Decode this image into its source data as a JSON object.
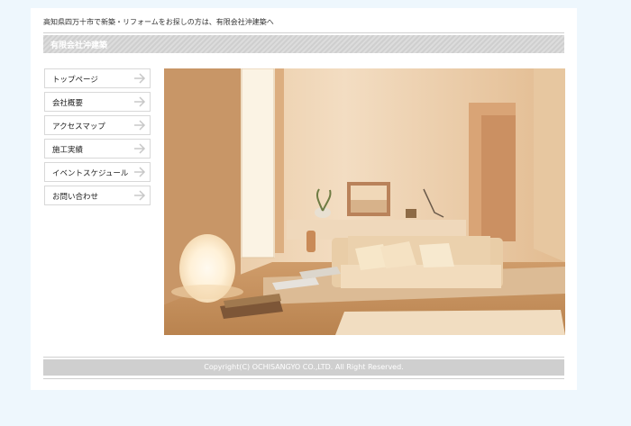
{
  "header": {
    "tagline": "高知県四万十市で新築・リフォームをお探しの方は、有限会社沖建築へ",
    "company_name": "有限会社沖建築"
  },
  "nav": {
    "items": [
      {
        "label": "トップページ",
        "icon": "arrow-right-icon"
      },
      {
        "label": "会社概要",
        "icon": "arrow-right-icon"
      },
      {
        "label": "アクセスマップ",
        "icon": "arrow-right-icon"
      },
      {
        "label": "施工実績",
        "icon": "arrow-right-icon"
      },
      {
        "label": "イベントスケジュール",
        "icon": "arrow-right-icon"
      },
      {
        "label": "お問い合わせ",
        "icon": "arrow-right-icon"
      }
    ]
  },
  "hero": {
    "description": "interior-living-room-photo"
  },
  "footer": {
    "copyright": "Copyright(C) OCHISANGYO CO.,LTD.  All Right Reserved."
  },
  "colors": {
    "background": "#eef7fd",
    "bar_gray": "#cfcfcf",
    "text": "#222222"
  }
}
